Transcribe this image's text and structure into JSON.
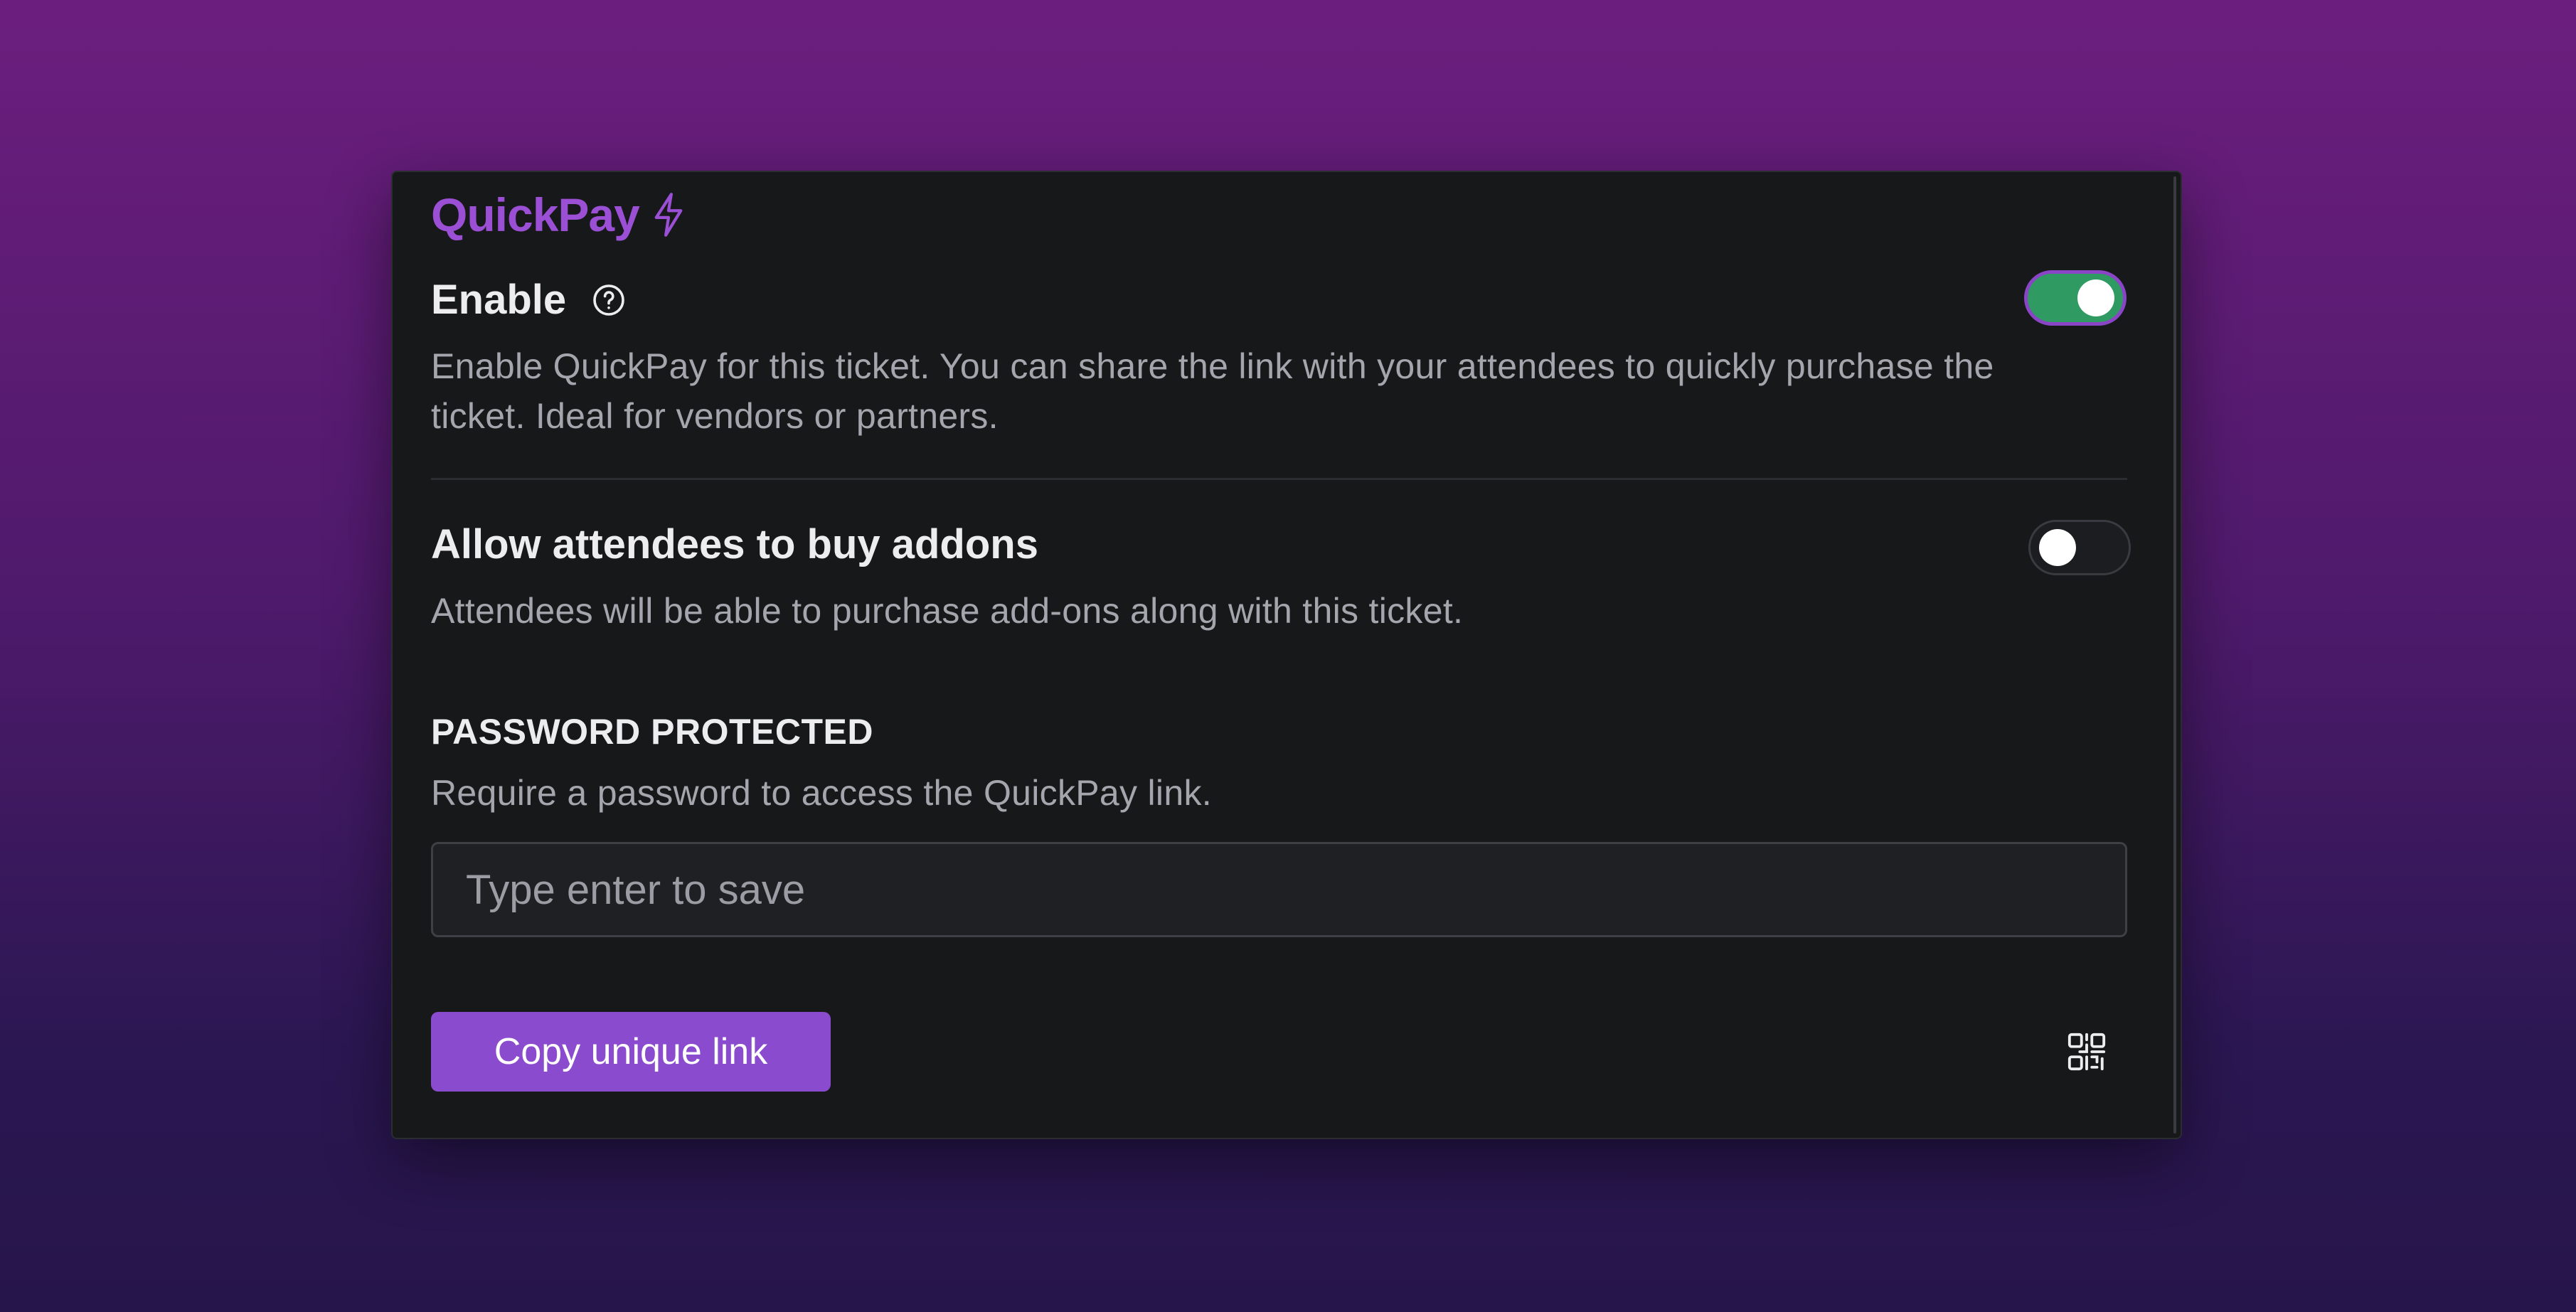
{
  "brand": {
    "name": "QuickPay",
    "icon": "bolt-icon",
    "color": "#9a4fd4"
  },
  "enable": {
    "title": "Enable",
    "help_icon": "help-circle-icon",
    "description": "Enable QuickPay for this ticket. You can share the link with your attendees to quickly purchase the ticket. Ideal for vendors or partners.",
    "toggle_on": true,
    "toggle_color": "#2f9a62"
  },
  "addons": {
    "title": "Allow attendees to buy addons",
    "description": "Attendees will be able to purchase add-ons along with this ticket.",
    "toggle_on": false
  },
  "password": {
    "title": "PASSWORD PROTECTED",
    "description": "Require a password to access the QuickPay link.",
    "placeholder": "Type enter to save",
    "value": ""
  },
  "actions": {
    "copy_label": "Copy unique link",
    "copy_color": "#8b4bce",
    "qr_icon": "qr-code-icon"
  }
}
